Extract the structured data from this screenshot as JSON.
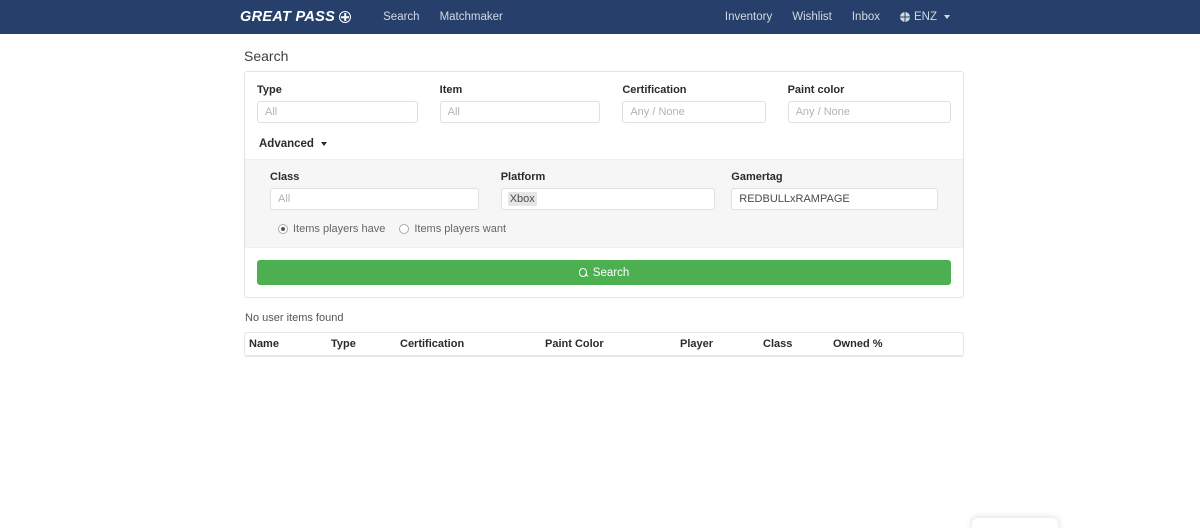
{
  "navbar": {
    "brand": "GREAT PASS",
    "brand_icon": "circle-crosshair-icon",
    "links": [
      {
        "label": "Search"
      },
      {
        "label": "Matchmaker"
      }
    ],
    "right_links": [
      {
        "label": "Inventory"
      },
      {
        "label": "Wishlist"
      },
      {
        "label": "Inbox"
      }
    ],
    "language": {
      "label": "ENZ",
      "icon": "globe-icon"
    },
    "background_color": "#27406b"
  },
  "page": {
    "title": "Search"
  },
  "search_form": {
    "basic_fields": [
      {
        "label": "Type",
        "value": "",
        "placeholder": "All"
      },
      {
        "label": "Item",
        "value": "",
        "placeholder": "All"
      },
      {
        "label": "Certification",
        "value": "",
        "placeholder": "Any / None"
      },
      {
        "label": "Paint color",
        "value": "",
        "placeholder": "Any / None"
      }
    ],
    "advanced_toggle": {
      "label": "Advanced",
      "icon": "caret-down-icon",
      "expanded": true
    },
    "advanced_fields": [
      {
        "label": "Class",
        "value": "",
        "placeholder": "All"
      },
      {
        "label": "Platform",
        "value": "Xbox",
        "placeholder": ""
      },
      {
        "label": "Gamertag",
        "value": "REDBULLxRAMPAGE",
        "placeholder": ""
      }
    ],
    "radio_options": [
      {
        "label": "Items players have",
        "selected": true
      },
      {
        "label": "Items players want",
        "selected": false
      }
    ],
    "submit": {
      "label": "Search",
      "icon": "magnifier-icon",
      "color": "#4cb050"
    }
  },
  "results": {
    "empty_message": "No user items found",
    "columns": [
      "Name",
      "Type",
      "Certification",
      "Paint Color",
      "Player",
      "Class",
      "Owned %"
    ],
    "rows": []
  }
}
